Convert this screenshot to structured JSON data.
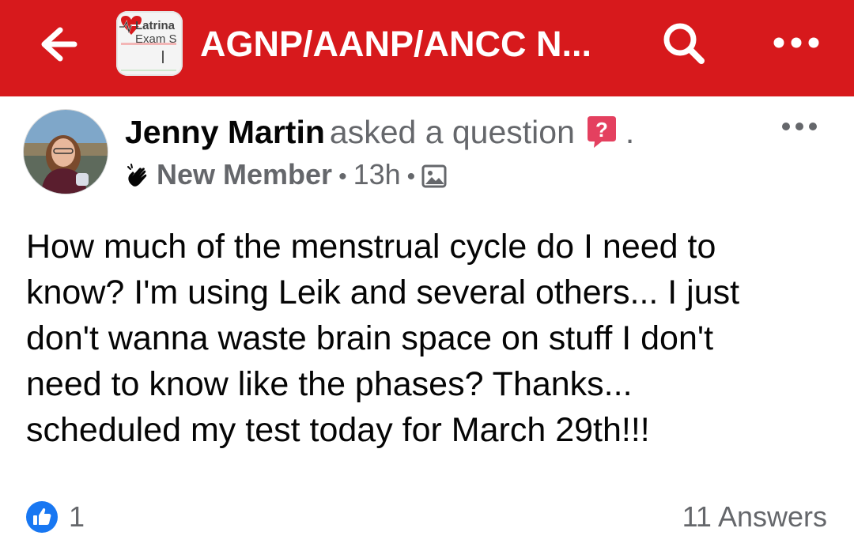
{
  "colors": {
    "brand_red": "#d7191c",
    "secondary_text": "#65676b",
    "like_blue": "#1877f2",
    "question_pink": "#e4405f"
  },
  "topbar": {
    "back_icon": "back-arrow-icon",
    "group_logo": {
      "line1": "Latrina",
      "line2": "Exam S"
    },
    "group_title": "AGNP/AANP/ANCC N...",
    "search_icon": "search-icon",
    "more_icon": "more-horizontal-icon"
  },
  "post": {
    "author": "Jenny Martin",
    "action": "asked a question",
    "action_icon": "question-badge-icon",
    "trailing": ".",
    "member_icon": "waving-hand-icon",
    "member_badge": "New Member",
    "separator": "•",
    "time": "13h",
    "audience_icon": "photo-icon",
    "body_lines": [
      "How much of the menstrual cycle do I need to",
      "know? I'm using Leik and several others... I just",
      "don't wanna waste brain space on stuff I don't",
      "need to know like the phases? Thanks...",
      "scheduled my test today for March 29th!!!"
    ],
    "like_count": "1",
    "answers_label": "11 Answers"
  }
}
